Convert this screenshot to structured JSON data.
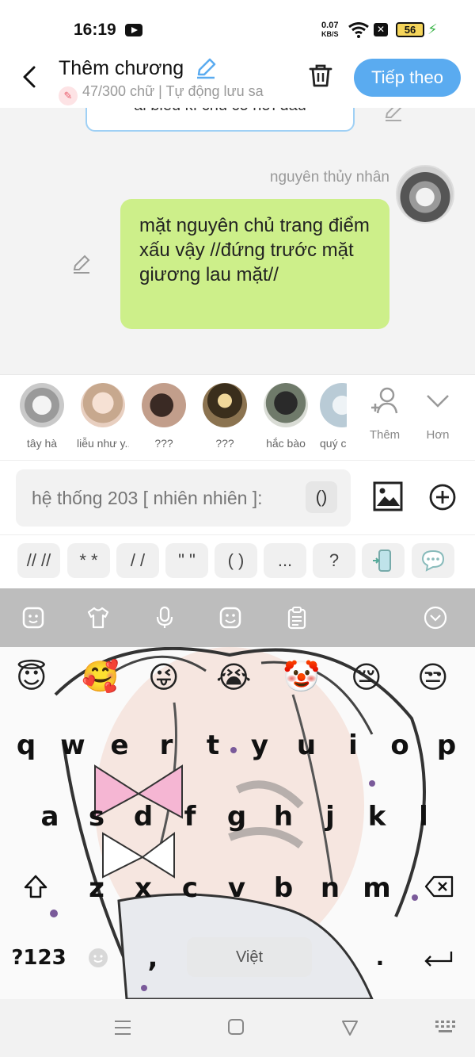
{
  "status_bar": {
    "time": "16:19",
    "speed_value": "0.07",
    "speed_unit": "KB/S",
    "battery": "56"
  },
  "header": {
    "title": "Thêm chương",
    "subtitle": "47/300 chữ | Tự động lưu sa",
    "next_label": "Tiếp theo"
  },
  "chat": {
    "previous_bubble_text": "ai biểu kì chủ có nơi đâu",
    "sender_name": "nguyên thủy nhân",
    "message_text": "mặt nguyên chủ trang điểm xấu vậy //đứng trước mặt giương lau mặt//"
  },
  "characters": [
    {
      "name": "tây hà",
      "color": "#c9c9c9"
    },
    {
      "name": "liễu như y...",
      "color": "#e8cfc0"
    },
    {
      "name": "???",
      "color": "#c29e8b"
    },
    {
      "name": "???",
      "color": "#8b7350"
    },
    {
      "name": "hắc bào",
      "color": "#6f7a6a"
    },
    {
      "name": "quý c",
      "color": "#b9cbd6"
    }
  ],
  "character_actions": {
    "add_label": "Thêm",
    "more_label": "Hơn"
  },
  "composer": {
    "placeholder": "hệ thống 203 [ nhiên nhiên ]:",
    "paren_chip": "()"
  },
  "quick_chips": [
    "// //",
    "* *",
    "/ /",
    "\" \"",
    "( )",
    "...",
    "?"
  ],
  "keyboard": {
    "emojis": [
      "😇",
      "🥰",
      "😜",
      "😭",
      "🤡",
      "😔",
      "😒"
    ],
    "row1": [
      "q",
      "w",
      "e",
      "r",
      "t",
      "y",
      "u",
      "i",
      "o",
      "p"
    ],
    "row2": [
      "a",
      "s",
      "d",
      "f",
      "g",
      "h",
      "j",
      "k",
      "l"
    ],
    "row3": [
      "z",
      "x",
      "c",
      "v",
      "b",
      "n",
      "m"
    ],
    "num_label": "?123",
    "space_label": "Việt",
    "comma_label": ","
  }
}
